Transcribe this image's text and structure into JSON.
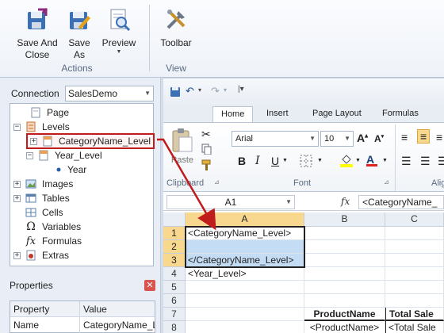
{
  "ribbon": {
    "buttons": [
      {
        "label": "Save And\nClose",
        "icon": "save-close-icon"
      },
      {
        "label": "Save\nAs",
        "icon": "save-as-icon"
      },
      {
        "label": "Preview",
        "icon": "preview-icon"
      },
      {
        "label": "Toolbar",
        "icon": "toolbar-icon"
      }
    ],
    "groups": {
      "actions": "Actions",
      "view": "View"
    }
  },
  "connection": {
    "label": "Connection",
    "value": "SalesDemo"
  },
  "tree": [
    {
      "label": "Page",
      "icon": "page-icon"
    },
    {
      "label": "Levels",
      "icon": "levels-icon"
    },
    {
      "label": "CategoryName_Level",
      "icon": "level-icon",
      "selected": true
    },
    {
      "label": "Year_Level",
      "icon": "level-icon"
    },
    {
      "label": "Year",
      "icon": "bullet-icon"
    },
    {
      "label": "Images",
      "icon": "images-icon"
    },
    {
      "label": "Tables",
      "icon": "tables-icon"
    },
    {
      "label": "Cells",
      "icon": "cells-icon"
    },
    {
      "label": "Variables",
      "icon": "omega-icon"
    },
    {
      "label": "Formulas",
      "icon": "fx-icon"
    },
    {
      "label": "Extras",
      "icon": "extras-icon"
    }
  ],
  "properties": {
    "title": "Properties",
    "columns": [
      "Property",
      "Value"
    ],
    "rows": [
      [
        "Name",
        "CategoryName_L"
      ]
    ]
  },
  "excel": {
    "tabs": [
      "Home",
      "Insert",
      "Page Layout",
      "Formulas"
    ],
    "active_tab": "Home",
    "font_name": "Arial",
    "font_size": "10",
    "paste_label": "Paste",
    "group_labels": {
      "clipboard": "Clipboard",
      "font": "Font",
      "alignment": "Alig"
    },
    "name_box": "A1",
    "fx": "fx",
    "formula": "<CategoryName_",
    "columns": [
      "A",
      "B",
      "C"
    ],
    "rows": [
      "1",
      "2",
      "3",
      "4",
      "5",
      "6",
      "7",
      "8"
    ],
    "cells": {
      "A1": "<CategoryName_Level>",
      "A3": "</CategoryName_Level>",
      "A4": "<Year_Level>",
      "B7": "ProductName",
      "C7": "Total Sale",
      "B8": "<ProductName>",
      "C8": "<Total Sale"
    }
  },
  "colors": {
    "accent_red": "#c01c1c",
    "selection_blue": "#c5dcf5",
    "active_header": "#f8d88f"
  }
}
